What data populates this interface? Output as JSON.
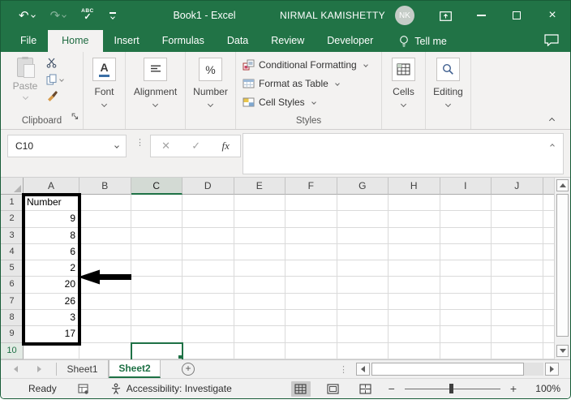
{
  "titlebar": {
    "title": "Book1 - Excel",
    "user": "NIRMAL KAMISHETTY",
    "avatar_initials": "NK"
  },
  "ribbon_tabs": {
    "items": [
      {
        "label": "File",
        "active": false
      },
      {
        "label": "Home",
        "active": true
      },
      {
        "label": "Insert",
        "active": false
      },
      {
        "label": "Formulas",
        "active": false
      },
      {
        "label": "Data",
        "active": false
      },
      {
        "label": "Review",
        "active": false
      },
      {
        "label": "Developer",
        "active": false
      }
    ],
    "tell_me": "Tell me"
  },
  "ribbon": {
    "clipboard": {
      "paste_label": "Paste",
      "group_label": "Clipboard"
    },
    "font": {
      "group_label": "Font",
      "icon_letter": "A"
    },
    "alignment": {
      "group_label": "Alignment"
    },
    "number": {
      "group_label": "Number",
      "icon_text": "%"
    },
    "styles": {
      "items": [
        "Conditional Formatting",
        "Format as Table",
        "Cell Styles"
      ],
      "group_label": "Styles"
    },
    "cells": {
      "group_label": "Cells"
    },
    "editing": {
      "group_label": "Editing"
    }
  },
  "formula_bar": {
    "name_box_value": "C10",
    "fx_label": "fx",
    "cancel_glyph": "✕",
    "enter_glyph": "✓",
    "formula_value": ""
  },
  "grid": {
    "columns": [
      "A",
      "B",
      "C",
      "D",
      "E",
      "F",
      "G",
      "H",
      "I",
      "J"
    ],
    "active_column": "C",
    "active_row": 10,
    "active_cell": "C10",
    "row_numbers": [
      1,
      2,
      3,
      4,
      5,
      6,
      7,
      8,
      9,
      10
    ],
    "column_a_values": [
      "Number",
      "9",
      "8",
      "6",
      "2",
      "20",
      "26",
      "3",
      "17",
      ""
    ]
  },
  "sheet_bar": {
    "sheets": [
      {
        "name": "Sheet1",
        "active": false
      },
      {
        "name": "Sheet2",
        "active": true
      }
    ],
    "add_label": "+"
  },
  "status_bar": {
    "mode": "Ready",
    "accessibility": "Accessibility: Investigate",
    "zoom_minus": "−",
    "zoom_plus": "+",
    "zoom_level": "100%"
  },
  "colors": {
    "excel_green": "#217346",
    "active_tab_text": "#1e6b41",
    "selection_border": "#1e7145",
    "annotation": "#000000",
    "ribbon_bg": "#f3f2f1"
  }
}
